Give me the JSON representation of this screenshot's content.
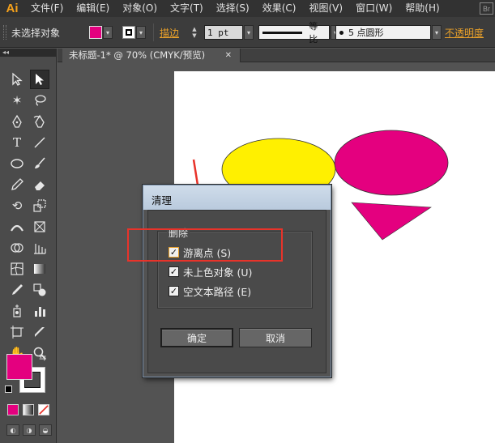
{
  "app": {
    "logo": "Ai",
    "br_badge": "Br"
  },
  "menu": [
    "文件(F)",
    "编辑(E)",
    "对象(O)",
    "文字(T)",
    "选择(S)",
    "效果(C)",
    "视图(V)",
    "窗口(W)",
    "帮助(H)"
  ],
  "controlbar": {
    "selection_status": "未选择对象",
    "stroke_label": "描边",
    "stroke_weight": "1 pt",
    "profile_label": "等比",
    "brush_label": "5 点圆形",
    "opacity_label": "不透明度"
  },
  "document": {
    "tab_title": "未标题-1* @ 70% (CMYK/预览)",
    "tab_close": "✕"
  },
  "dialog": {
    "title": "清理",
    "group_label": "删除",
    "options": [
      {
        "label": "游离点 (S)",
        "checked": true
      },
      {
        "label": "未上色对象 (U)",
        "checked": true
      },
      {
        "label": "空文本路径 (E)",
        "checked": true
      }
    ],
    "ok_label": "确定",
    "cancel_label": "取消"
  },
  "colors": {
    "fill": "#e4007f",
    "ellipse_yellow": "#fff000",
    "ellipse_magenta": "#e4007f",
    "triangle": "#e4007f",
    "annotation": "#e8332a",
    "accent_link": "#e8a02a"
  },
  "icons": {
    "check": "✓",
    "swap": "⇆",
    "dropdown": "▾"
  }
}
